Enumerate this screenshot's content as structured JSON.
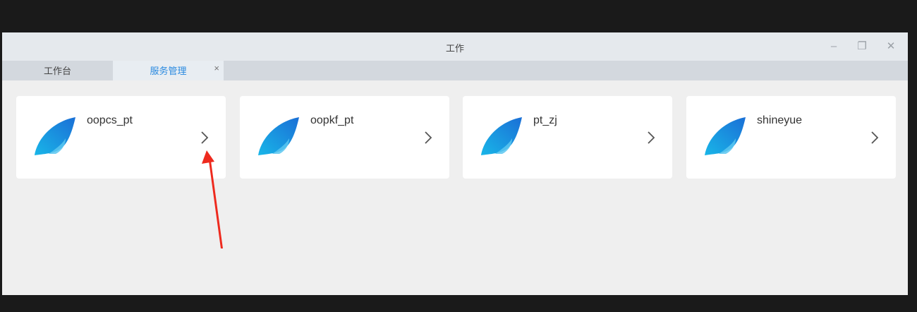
{
  "window": {
    "title": "工作",
    "controls": {
      "minimize": "–",
      "maximize": "❐",
      "close": "✕"
    }
  },
  "tabs": [
    {
      "label": "工作台",
      "active": false
    },
    {
      "label": "服务管理",
      "active": true,
      "close": "×"
    }
  ],
  "services": [
    {
      "name": "oopcs_pt"
    },
    {
      "name": "oopkf_pt"
    },
    {
      "name": "pt_zj"
    },
    {
      "name": "shineyue"
    }
  ],
  "colors": {
    "accent": "#2a8ae0",
    "annotation": "#ee2a1e"
  }
}
